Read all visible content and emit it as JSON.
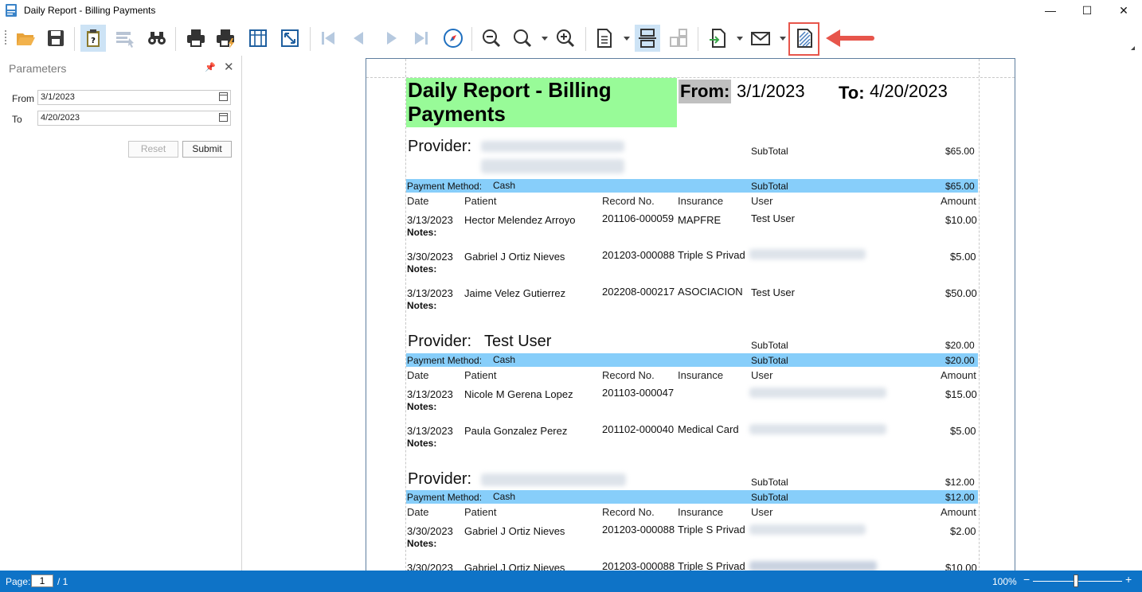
{
  "window": {
    "title": "Daily Report - Billing Payments",
    "controls": [
      "minimize-icon",
      "maximize-icon",
      "close-icon"
    ],
    "minimize_glyph": "—",
    "maximize_glyph": "☐",
    "close_glyph": "✕"
  },
  "toolbar": {
    "icons": [
      "open-folder-icon",
      "save-icon",
      "parameters-icon",
      "document-map-icon",
      "find-icon",
      "print-icon",
      "quick-print-icon",
      "page-setup-icon",
      "scale-icon",
      "first-page-icon",
      "previous-page-icon",
      "next-page-icon",
      "last-page-icon",
      "navigation-icon",
      "zoom-out-icon",
      "zoom-icon",
      "zoom-in-icon",
      "view-options-icon",
      "multiple-pages-icon",
      "continuous-pages-icon",
      "export-icon",
      "send-email-icon",
      "watermark-icon"
    ],
    "highlighted": "watermark-icon",
    "highlight_color": "#e7554b"
  },
  "params": {
    "title": "Parameters",
    "pin_glyph": "📌",
    "close_glyph": "✕",
    "from_label": "From",
    "from_value": "3/1/2023",
    "to_label": "To",
    "to_value": "4/20/2023",
    "reset_label": "Reset",
    "submit_label": "Submit"
  },
  "report": {
    "title_line1": "Daily Report - Billing",
    "title_line2": "Payments",
    "from_label": "From:",
    "from_value": "3/1/2023",
    "to_label": "To:",
    "to_value": "4/20/2023",
    "title_bg": "#98fb98",
    "band_color": "#87cefa",
    "col_headers": {
      "date": "Date",
      "patient": "Patient",
      "record": "Record No.",
      "insurance": "Insurance",
      "user": "User",
      "amount": "Amount"
    },
    "subtotal_label": "SubTotal",
    "provider_label": "Provider:",
    "payment_method_label": "Payment Method:",
    "notes_label": "Notes:",
    "groups": [
      {
        "provider": "",
        "provider_subtotal": "$65.00",
        "method": "Cash",
        "method_subtotal": "$65.00",
        "rows": [
          {
            "date": "3/13/2023",
            "patient": "Hector Melendez Arroyo",
            "record": "201106-000059",
            "insurance": "MAPFRE",
            "user": "Test User",
            "amount": "$10.00"
          },
          {
            "date": "3/30/2023",
            "patient": "Gabriel J Ortiz Nieves",
            "record": "201203-000088",
            "insurance": "Triple S Privad",
            "user": "",
            "amount": "$5.00"
          },
          {
            "date": "3/13/2023",
            "patient": "Jaime Velez Gutierrez",
            "record": "202208-000217",
            "insurance": "ASOCIACION",
            "user": "Test User",
            "amount": "$50.00"
          }
        ]
      },
      {
        "provider": "Test User",
        "provider_subtotal": "$20.00",
        "method": "Cash",
        "method_subtotal": "$20.00",
        "rows": [
          {
            "date": "3/13/2023",
            "patient": "Nicole M Gerena Lopez",
            "record": "201103-000047",
            "insurance": "",
            "user": "",
            "amount": "$15.00"
          },
          {
            "date": "3/13/2023",
            "patient": "Paula Gonzalez Perez",
            "record": "201102-000040",
            "insurance": "Medical Card",
            "user": "",
            "amount": "$5.00"
          }
        ]
      },
      {
        "provider": "",
        "provider_subtotal": "$12.00",
        "method": "Cash",
        "method_subtotal": "$12.00",
        "rows": [
          {
            "date": "3/30/2023",
            "patient": "Gabriel J Ortiz Nieves",
            "record": "201203-000088",
            "insurance": "Triple S Privad",
            "user": "",
            "amount": "$2.00"
          },
          {
            "date": "3/30/2023",
            "patient": "Gabriel J Ortiz Nieves",
            "record": "201203-000088",
            "insurance": "Triple S Privad",
            "user": "",
            "amount": "$10.00"
          }
        ]
      }
    ]
  },
  "status": {
    "page_label": "Page:",
    "page_current": "1",
    "page_total": "/ 1",
    "zoom": "100%",
    "zoom_minus": "−",
    "zoom_plus": "+",
    "bar_color": "#0e73c7"
  }
}
